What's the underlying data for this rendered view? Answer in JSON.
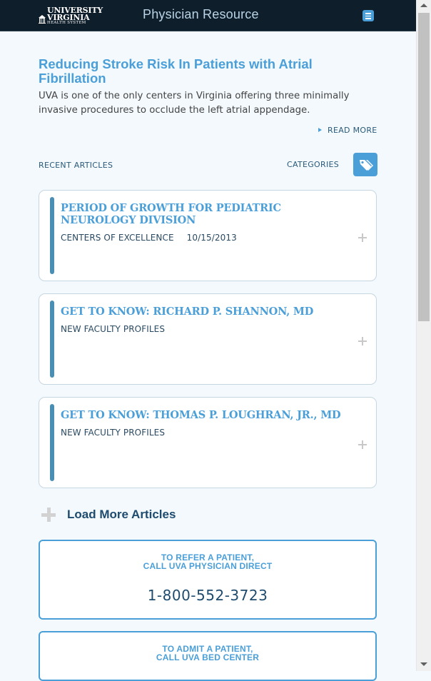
{
  "header": {
    "logo_line1": "UNIVERSITY",
    "logo_line2": "VIRGINIA",
    "logo_line3": "HEALTH SYSTEM",
    "title": "Physician Resource",
    "menu_icon": "hamburger-menu-icon"
  },
  "feature": {
    "title": "Reducing Stroke Risk In Patients with Atrial Fibrillation",
    "description": "UVA is one of the only centers in Virginia offering three minimally invasive procedures to occlude the left atrial appendage.",
    "read_more": "READ MORE"
  },
  "articles_header": {
    "recent_label": "RECENT ARTICLES",
    "categories_label": "CATEGORIES",
    "categories_icon": "tag-icon"
  },
  "articles": [
    {
      "title": "PERIOD OF GROWTH FOR PEDIATRIC NEUROLOGY DIVISION",
      "category": "CENTERS OF EXCELLENCE",
      "date": "10/15/2013"
    },
    {
      "title": "GET TO KNOW: RICHARD P. SHANNON, MD",
      "category": "NEW FACULTY PROFILES",
      "date": ""
    },
    {
      "title": "GET TO KNOW: THOMAS P. LOUGHRAN, JR., MD",
      "category": "NEW FACULTY PROFILES",
      "date": ""
    }
  ],
  "load_more": "Load More Articles",
  "cta": [
    {
      "line1": "TO REFER A PATIENT,",
      "line2": "CALL UVA PHYSICIAN DIRECT",
      "phone": "1-800-552-3723"
    },
    {
      "line1": "TO ADMIT A PATIENT,",
      "line2": "CALL UVA BED CENTER",
      "phone": ""
    }
  ],
  "colors": {
    "accent": "#4a9fd9",
    "header_bg": "#0f1e2b",
    "page_bg": "#f3f9fd",
    "dark_text": "#1e4b6e"
  }
}
